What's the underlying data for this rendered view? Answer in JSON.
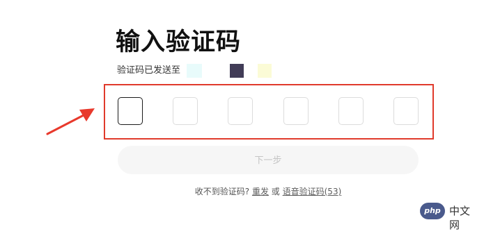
{
  "header": {
    "title": "输入验证码",
    "subtitle": "验证码已发送至"
  },
  "redacted_swatches": [
    "#e8fbfb",
    "#413c57",
    "#fbfbd6"
  ],
  "code_inputs": {
    "count": 6,
    "active_index": 0,
    "values": [
      "",
      "",
      "",
      "",
      "",
      ""
    ]
  },
  "next_button": {
    "label": "下一步",
    "enabled": false
  },
  "resend": {
    "prompt": "收不到验证码?",
    "resend_link": "重发",
    "separator": "或",
    "voice_link": "语音验证码(53)"
  },
  "annotation": {
    "box_color": "#e03a2b",
    "arrow_color": "#e8392c"
  },
  "watermark": {
    "logo_text": "php",
    "label": "中文网"
  }
}
